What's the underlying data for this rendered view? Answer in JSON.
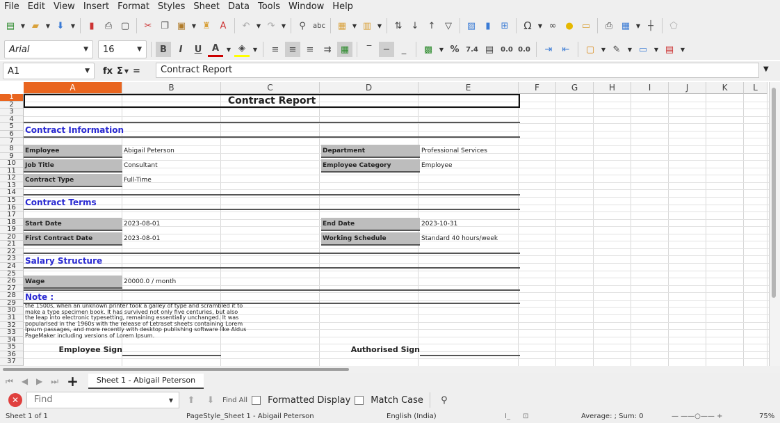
{
  "menu": [
    "File",
    "Edit",
    "View",
    "Insert",
    "Format",
    "Styles",
    "Sheet",
    "Data",
    "Tools",
    "Window",
    "Help"
  ],
  "toolbar2": {
    "font_name": "Arial",
    "font_size": "16"
  },
  "formula_bar": {
    "cell_ref": "A1",
    "fx": "fx",
    "sigma": "Σ",
    "equals": "=",
    "content": "Contract Report"
  },
  "columns": [
    "A",
    "B",
    "C",
    "D",
    "E",
    "F",
    "G",
    "H",
    "I",
    "J",
    "K",
    "L"
  ],
  "rows": [
    "1",
    "2",
    "3",
    "4",
    "5",
    "6",
    "7",
    "8",
    "9",
    "10",
    "11",
    "12",
    "13",
    "14",
    "15",
    "16",
    "17",
    "18",
    "19",
    "20",
    "21",
    "22",
    "23",
    "24",
    "25",
    "26",
    "27",
    "28",
    "29",
    "30",
    "31",
    "32",
    "33",
    "34",
    "35",
    "36",
    "37"
  ],
  "sheet": {
    "title": "Contract Report",
    "sections": {
      "contract_information": "Contract Information",
      "contract_terms": "Contract Terms",
      "salary_structure": "Salary Structure",
      "note": "Note :"
    },
    "fields": {
      "employee_label": "Employee",
      "employee_value": "Abigail Peterson",
      "department_label": "Department",
      "department_value": "Professional Services",
      "job_title_label": "Job Title",
      "job_title_value": "Consultant",
      "employee_category_label": "Employee Category",
      "employee_category_value": "Employee",
      "contract_type_label": "Contract Type",
      "contract_type_value": "Full-Time",
      "start_date_label": "Start Date",
      "start_date_value": "2023-08-01",
      "end_date_label": "End Date",
      "end_date_value": "2023-10-31",
      "first_contract_label": "First Contract Date",
      "first_contract_value": "2023-08-01",
      "working_schedule_label": "Working Schedule",
      "working_schedule_value": "Standard 40 hours/week",
      "wage_label": "Wage",
      "wage_value": "20000.0 / month"
    },
    "note_text": "the 1500s, when an unknown printer took a galley of type and scrambled it to make a type specimen book. It has survived not only five centuries, but also the leap into electronic typesetting, remaining essentially unchanged. It was popularised in the 1960s with the release of Letraset sheets containing Lorem Ipsum passages, and more recently with desktop publishing software like Aldus PageMaker including versions of Lorem Ipsum.",
    "employee_sign": "Employee Sign",
    "authorised_sign": "Authorised Sign"
  },
  "sheet_tab": "Sheet 1 - Abigail Peterson",
  "find": {
    "placeholder": "Find",
    "find_all": "Find All",
    "formatted_display": "Formatted Display",
    "match_case": "Match Case"
  },
  "status": {
    "sheet": "Sheet 1 of 1",
    "page_style": "PageStyle_Sheet 1 - Abigail Peterson",
    "language": "English (India)",
    "summary": "Average: ; Sum: 0",
    "zoom": "75%"
  }
}
